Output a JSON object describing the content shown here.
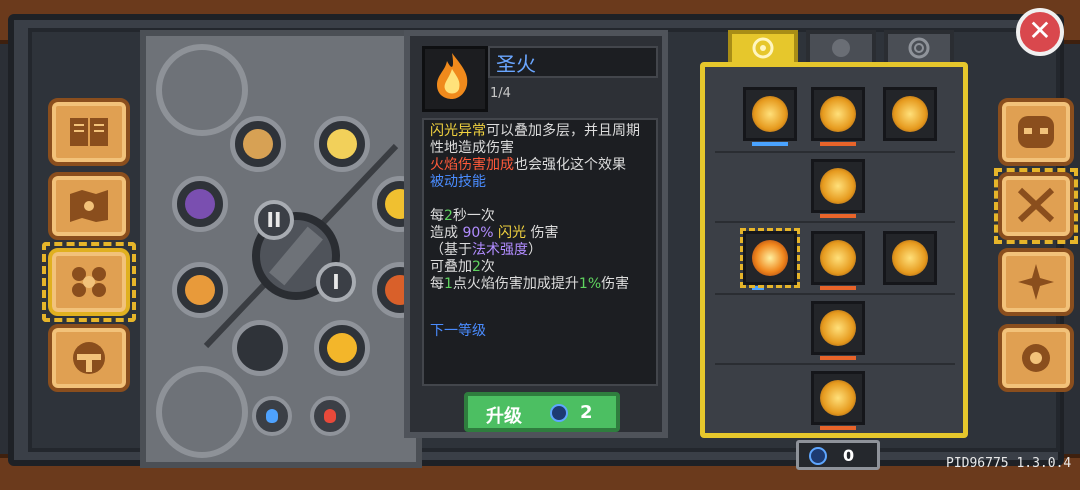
{
  "skill": {
    "name": "圣火",
    "level": "1/4",
    "desc_line1_a": "闪光异常",
    "desc_line1_b": "可以叠加多层，并且周期性地造成伤害",
    "desc_line2_a": "火焰伤害加成",
    "desc_line2_b": "也会强化这个效果",
    "passive": "被动技能",
    "s1_a": "每",
    "s1_b": "2",
    "s1_c": "秒一次",
    "s2_a": "造成 ",
    "s2_b": "90%",
    "s2_c": " 闪光",
    "s2_d": " 伤害",
    "s3_a": "（基于",
    "s3_b": "法术强度",
    "s3_c": "）",
    "s4_a": "可叠加",
    "s4_b": "2",
    "s4_c": "次",
    "s5_a": "每",
    "s5_b": "1",
    "s5_c": "点火焰伤害加成提升",
    "s5_d": "1%",
    "s5_e": "伤害",
    "next_level": "下一等级"
  },
  "upgrade": {
    "label": "升级",
    "cost": "2"
  },
  "balance": {
    "value": "0"
  },
  "version": "PID96775 1.3.0.4",
  "close": "✕",
  "roman": {
    "one": "I",
    "two": "II"
  },
  "colors": {
    "accent_yellow": "#e6c72c",
    "upgrade_green": "#4cbf62",
    "close_red": "#d9484d",
    "skill_name_blue": "#6aa6ff"
  }
}
